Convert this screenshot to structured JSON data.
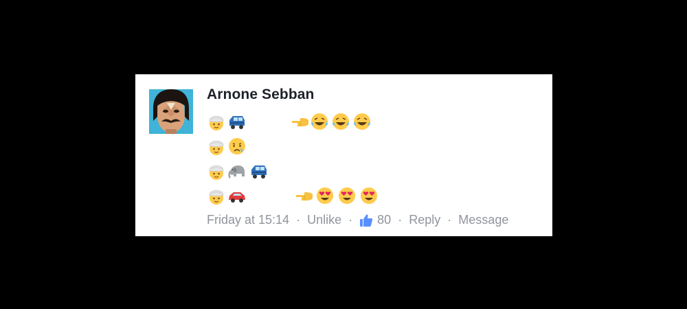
{
  "comment": {
    "author": "Arnone Sebban",
    "lines": [
      [
        "person-with-turban-icon",
        "blue-car-icon",
        "backhand-index-pointing-left-icon",
        "face-with-tears-of-joy-icon",
        "face-with-tears-of-joy-icon",
        "face-with-tears-of-joy-icon"
      ],
      [
        "person-with-turban-icon",
        "crying-face-icon"
      ],
      [
        "person-with-turban-icon",
        "elephant-icon",
        "blue-car-icon"
      ],
      [
        "person-with-turban-icon",
        "red-car-icon",
        "backhand-index-pointing-left-icon",
        "smiling-face-with-heart-eyes-icon",
        "smiling-face-with-heart-eyes-icon",
        "smiling-face-with-heart-eyes-icon"
      ]
    ],
    "meta": {
      "time": "Friday at 15:14",
      "separator": "·",
      "unlike": "Unlike",
      "like_count": "80",
      "reply": "Reply",
      "message": "Message"
    }
  },
  "colors": {
    "background": "#000000",
    "card": "#ffffff",
    "name": "#1d2129",
    "meta_text": "#90949c",
    "like_blue": "#5890ff"
  }
}
